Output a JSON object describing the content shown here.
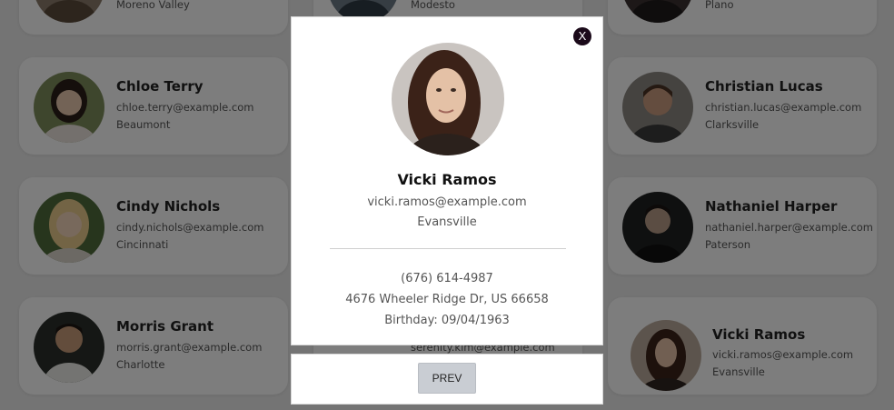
{
  "background_cards": [
    {
      "name": "",
      "email": "",
      "city": "Moreno Valley"
    },
    {
      "name": "",
      "email": "",
      "city": "Modesto"
    },
    {
      "name": "",
      "email": "",
      "city": "Plano"
    },
    {
      "name": "Chloe Terry",
      "email": "chloe.terry@example.com",
      "city": "Beaumont"
    },
    {
      "name": "Christian Lucas",
      "email": "christian.lucas@example.com",
      "city": "Clarksville"
    },
    {
      "name": "Cindy Nichols",
      "email": "cindy.nichols@example.com",
      "city": "Cincinnati"
    },
    {
      "name": "Nathaniel Harper",
      "email": "nathaniel.harper@example.com",
      "city": "Paterson"
    },
    {
      "name": "Morris Grant",
      "email": "morris.grant@example.com",
      "city": "Charlotte"
    },
    {
      "name": "",
      "email": "serenity.kim@example.com",
      "city": ""
    },
    {
      "name": "Vicki Ramos",
      "email": "vicki.ramos@example.com",
      "city": "Evansville"
    }
  ],
  "modal": {
    "close_label": "X",
    "name": "Vicki Ramos",
    "email": "vicki.ramos@example.com",
    "city": "Evansville",
    "phone": "(676) 614-4987",
    "address": "4676 Wheeler Ridge Dr, US 66658",
    "birthday": "Birthday: 09/04/1963"
  },
  "navigation": {
    "prev_label": "PREV"
  },
  "colors": {
    "overlay": "#000000",
    "close_button": "#1b0a1a",
    "prev_button": "#c9cdd3"
  }
}
